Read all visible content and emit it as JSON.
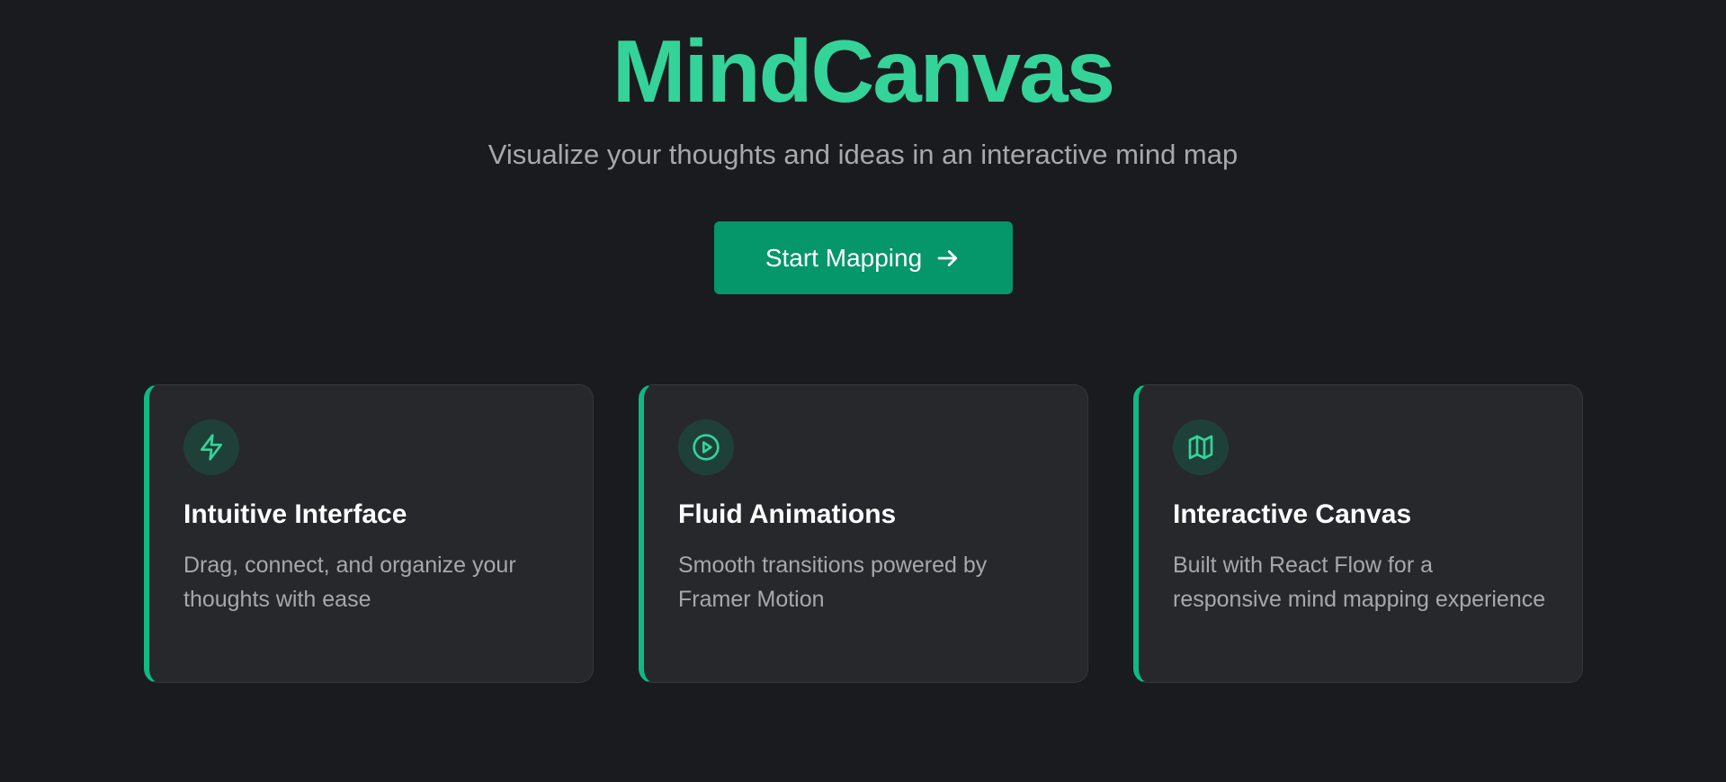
{
  "hero": {
    "title": "MindCanvas",
    "subtitle": "Visualize your thoughts and ideas in an interactive mind map",
    "cta_label": "Start Mapping",
    "cta_icon": "arrow-right-icon"
  },
  "features": [
    {
      "icon": "lightning-bolt-icon",
      "title": "Intuitive Interface",
      "description": "Drag, connect, and organize your thoughts with ease"
    },
    {
      "icon": "play-circle-icon",
      "title": "Fluid Animations",
      "description": "Smooth transitions powered by Framer Motion"
    },
    {
      "icon": "map-icon",
      "title": "Interactive Canvas",
      "description": "Built with React Flow for a responsive mind mapping experience"
    }
  ],
  "colors": {
    "background": "#1a1b1e",
    "accent": "#34d399",
    "button": "#059669",
    "card": "#27282b",
    "card_border_accent": "#10b981",
    "muted_text": "#a6a8ae"
  }
}
